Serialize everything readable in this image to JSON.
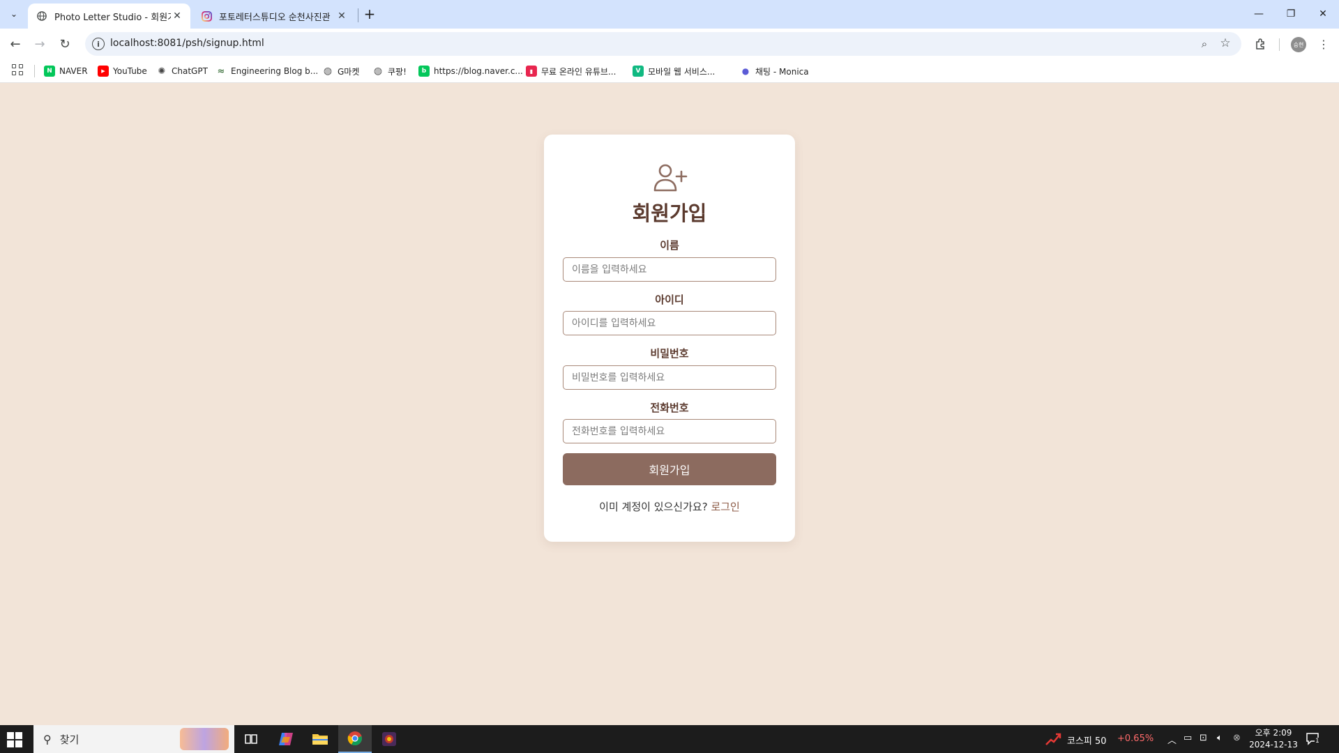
{
  "browser": {
    "tabs": [
      {
        "title": "Photo Letter Studio - 회원가입"
      },
      {
        "title": "포토레터스튜디오 순천사진관"
      }
    ],
    "url": "localhost:8081/psh/signup.html",
    "profile_initials": "승현",
    "bookmarks": [
      {
        "label": "NAVER",
        "icon_text": "N",
        "color": "#03c75a"
      },
      {
        "label": "YouTube",
        "icon_text": "▶",
        "color": "#ff0000"
      },
      {
        "label": "ChatGPT",
        "icon_text": "✺",
        "color": "#444444"
      },
      {
        "label": "Engineering Blog b...",
        "icon_text": "≈",
        "color": "#4a7b4a"
      },
      {
        "label": "G마켓",
        "icon_text": "◍",
        "color": "#555555"
      },
      {
        "label": "쿠팡!",
        "icon_text": "◍",
        "color": "#555555"
      },
      {
        "label": "https://blog.naver.c...",
        "icon_text": "b",
        "color": "#03c75a"
      },
      {
        "label": "무료 온라인 유튜브...",
        "icon_text": "▮",
        "color": "#e8264f"
      },
      {
        "label": "모바일 웹 서비스...",
        "icon_text": "V",
        "color": "#10b981"
      },
      {
        "label": "채팅 - Monica",
        "icon_text": "●",
        "color": "#5b5bd6"
      }
    ]
  },
  "signup": {
    "title": "회원가입",
    "fields": [
      {
        "label": "이름",
        "placeholder": "이름을 입력하세요",
        "value": ""
      },
      {
        "label": "아이디",
        "placeholder": "아이디를 입력하세요",
        "value": ""
      },
      {
        "label": "비밀번호",
        "placeholder": "비밀번호를 입력하세요",
        "value": ""
      },
      {
        "label": "전화번호",
        "placeholder": "전화번호를 입력하세요",
        "value": ""
      }
    ],
    "submit_label": "회원가입",
    "login_prompt": "이미 계정이 있으신가요?",
    "login_link": "로그인"
  },
  "colors": {
    "page_background": "#f2e4d8",
    "accent": "#8c6b5f",
    "title_text": "#5b3a2e"
  },
  "taskbar": {
    "search_label": "찾기",
    "stock_name": "코스피 50",
    "stock_change": "+0.65%",
    "stock_change_color": "#ff6b6b",
    "time": "오후 2:09",
    "date": "2024-12-13",
    "notification_count": "1"
  }
}
